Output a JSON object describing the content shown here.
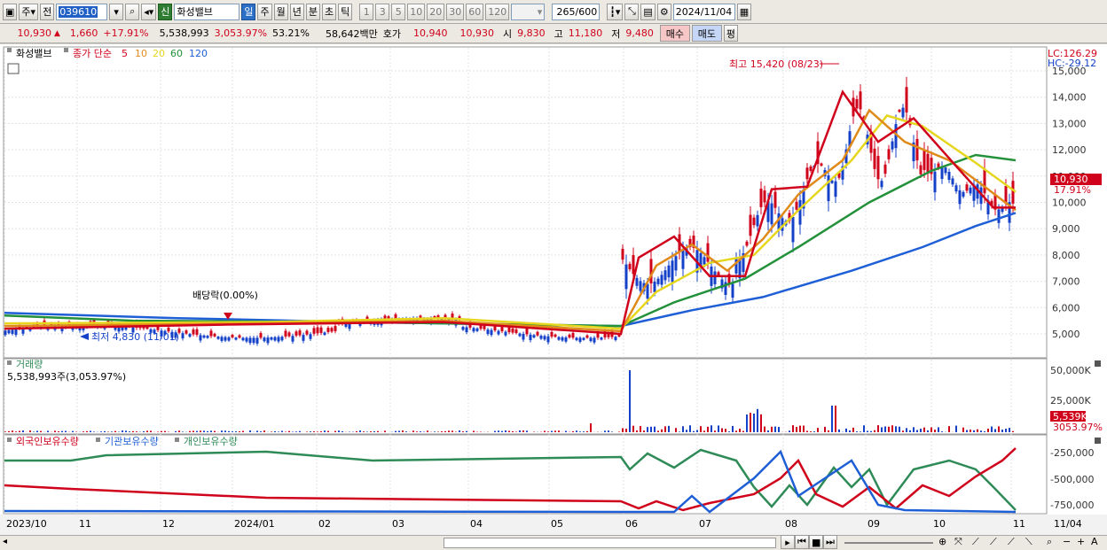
{
  "toolbar": {
    "market": "주",
    "type": "전",
    "code": "039610",
    "stock_name": "화성밸브",
    "new_badge": "신",
    "periods": [
      "일",
      "주",
      "월",
      "년",
      "분",
      "초",
      "틱"
    ],
    "minutes": [
      "1",
      "3",
      "5",
      "10",
      "20",
      "30",
      "60",
      "120"
    ],
    "count": "265",
    "count_max": "/600",
    "date": "2024/11/04"
  },
  "info": {
    "price": "10,930",
    "change": "1,660",
    "rate": "+17.91%",
    "volume": "5,538,993",
    "vol_rate": "3,053.97%",
    "turnover": "53.21%",
    "amount": "58,642백만",
    "ask_label": "호가",
    "ask": "10,940",
    "bid": "10,930",
    "open_label": "시",
    "open": "9,830",
    "high_label": "고",
    "high": "11,180",
    "low_label": "저",
    "low": "9,480",
    "buy": "매수",
    "sell": "매도",
    "avg": "평"
  },
  "price_panel": {
    "stock": "화성밸브",
    "ma_label": "종가 단순",
    "ma": [
      {
        "p": "5",
        "color": "#d0021b"
      },
      {
        "p": "10",
        "color": "#e08a1a"
      },
      {
        "p": "20",
        "color": "#e6d61e"
      },
      {
        "p": "60",
        "color": "#23913a"
      },
      {
        "p": "120",
        "color": "#1f5fd6"
      }
    ],
    "lc": "LC:126.29",
    "hc": "HC:-29.12",
    "high_note": "최고 15,420 (08/23)",
    "low_note": "최저 4,830 (11/01)",
    "ex_note": "배당락(0.00%)",
    "last_price": "10,930",
    "last_rate": "17.91%",
    "y_ticks": [
      "15,000",
      "14,000",
      "13,000",
      "12,000",
      "11,000",
      "10,000",
      "9,000",
      "8,000",
      "7,000",
      "6,000",
      "5,000"
    ]
  },
  "volume_panel": {
    "title": "거래량",
    "value": "5,538,993주(3,053.97%)",
    "ticks": [
      "50,000K",
      "25,000K"
    ],
    "last": "5,539K",
    "last_rate": "3053.97%"
  },
  "holding_panel": {
    "foreign": "외국인보유수량",
    "inst": "기관보유수량",
    "indiv": "개인보유수량",
    "ticks": [
      "-250,000",
      "-500,000",
      "-750,000"
    ]
  },
  "x_axis": [
    "2023/10",
    "11",
    "12",
    "2024/01",
    "02",
    "03",
    "04",
    "05",
    "06",
    "07",
    "08",
    "09",
    "10",
    "11",
    "11/04"
  ],
  "colors": {
    "up": "#d0021b",
    "down": "#1540c8",
    "foreign": "#d0021b",
    "inst": "#1f5fd6",
    "indiv": "#2e8b57"
  }
}
